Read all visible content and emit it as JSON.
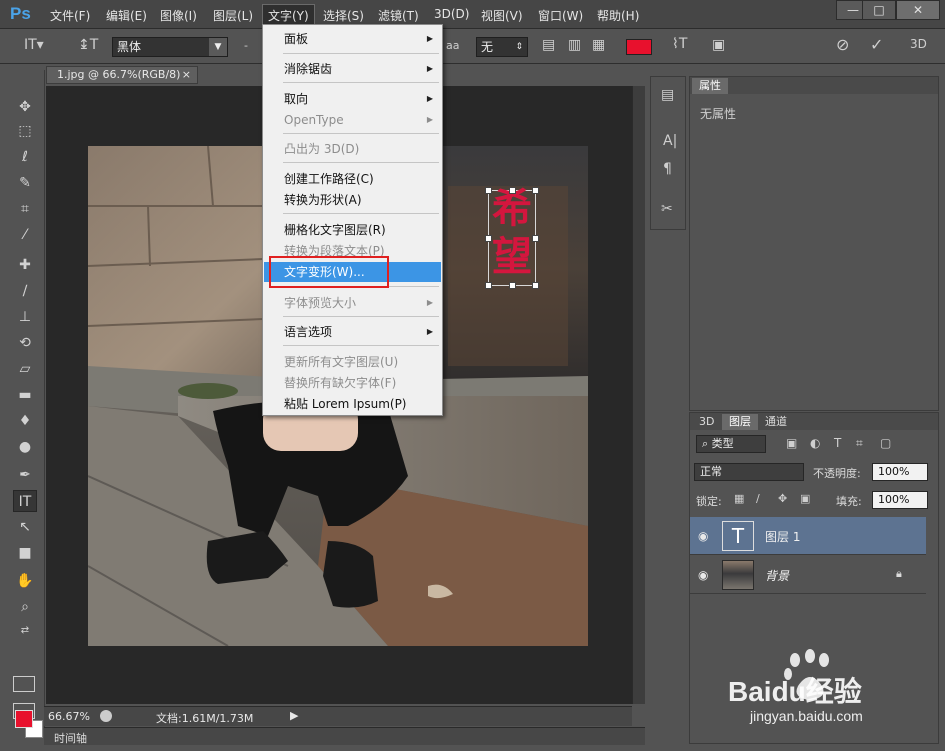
{
  "app": {
    "logo": "Ps"
  },
  "menubar": {
    "items": [
      "文件(F)",
      "编辑(E)",
      "图像(I)",
      "图层(L)",
      "文字(Y)",
      "选择(S)",
      "滤镜(T)",
      "3D(D)",
      "视图(V)",
      "窗口(W)",
      "帮助(H)"
    ],
    "active": "文字(Y)",
    "window_buttons": [
      "—",
      "□",
      "✕"
    ]
  },
  "options": {
    "font_family": "黑体",
    "font_style": "-",
    "aa_label": "aa",
    "aa_value": "无",
    "text_color": "#e8112d",
    "mode_3d": "3D"
  },
  "document": {
    "tab_title": "1.jpg @ 66.7%(RGB/8)",
    "tab_close": "×",
    "zoom": "66.67%",
    "doc_info": "文档:1.61M/1.73M",
    "text_layer_content": [
      "希",
      "望"
    ]
  },
  "text_menu": {
    "items": [
      {
        "label": "面板",
        "submenu": true,
        "disabled": false
      },
      {
        "label": "消除锯齿",
        "submenu": true,
        "disabled": false
      },
      {
        "label": "取向",
        "submenu": true,
        "disabled": false
      },
      {
        "label": "OpenType",
        "submenu": true,
        "disabled": true
      },
      {
        "label": "凸出为 3D(D)",
        "submenu": false,
        "disabled": true
      },
      {
        "label": "创建工作路径(C)",
        "submenu": false,
        "disabled": false
      },
      {
        "label": "转换为形状(A)",
        "submenu": false,
        "disabled": false
      },
      {
        "label": "栅格化文字图层(R)",
        "submenu": false,
        "disabled": false
      },
      {
        "label": "转换为段落文本(P)",
        "submenu": false,
        "disabled": true
      },
      {
        "label": "文字变形(W)...",
        "submenu": false,
        "disabled": false,
        "highlighted": true
      },
      {
        "label": "字体预览大小",
        "submenu": true,
        "disabled": true
      },
      {
        "label": "语言选项",
        "submenu": true,
        "disabled": false
      },
      {
        "label": "更新所有文字图层(U)",
        "submenu": false,
        "disabled": true
      },
      {
        "label": "替换所有缺欠字体(F)",
        "submenu": false,
        "disabled": true
      },
      {
        "label": "粘贴 Lorem Ipsum(P)",
        "submenu": false,
        "disabled": false
      }
    ]
  },
  "properties_panel": {
    "tab": "属性",
    "empty_text": "无属性"
  },
  "layers_panel": {
    "tabs": [
      "3D",
      "图层",
      "通道"
    ],
    "active_tab": "图层",
    "filter_kind": "类型",
    "blend_mode": "正常",
    "opacity_label": "不透明度:",
    "opacity": "100%",
    "lock_label": "锁定:",
    "fill_label": "填充:",
    "fill": "100%",
    "layers": [
      {
        "name": "图层 1",
        "type": "text",
        "thumb": "T",
        "selected": true
      },
      {
        "name": "背景",
        "type": "image",
        "locked": true,
        "selected": false
      }
    ]
  },
  "timeline": {
    "label": "时间轴"
  },
  "watermark": {
    "brand": "Baidu经验",
    "url": "jingyan.baidu.com"
  }
}
